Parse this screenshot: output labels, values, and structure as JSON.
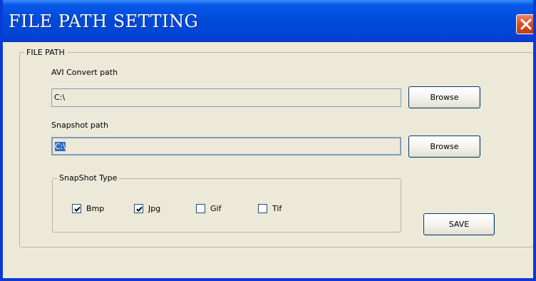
{
  "window": {
    "title": "FILE PATH SETTING",
    "close_icon": "close-x-icon",
    "close_color": "#d8542a",
    "titlebar_color": "#0049d8"
  },
  "file_path_group": {
    "legend": "FILE PATH",
    "avi": {
      "label": "AVI Convert  path",
      "value": "C:\\",
      "browse_label": "Browse"
    },
    "snapshot": {
      "label": "Snapshot path",
      "value": "C:\\",
      "browse_label": "Browse",
      "value_selected": true
    }
  },
  "snapshot_type_group": {
    "legend": "SnapShot Type",
    "options": [
      {
        "label": "Bmp",
        "checked": true
      },
      {
        "label": "Jpg",
        "checked": true
      },
      {
        "label": "Gif",
        "checked": false
      },
      {
        "label": "Tif",
        "checked": false
      }
    ]
  },
  "save_label": "SAVE"
}
